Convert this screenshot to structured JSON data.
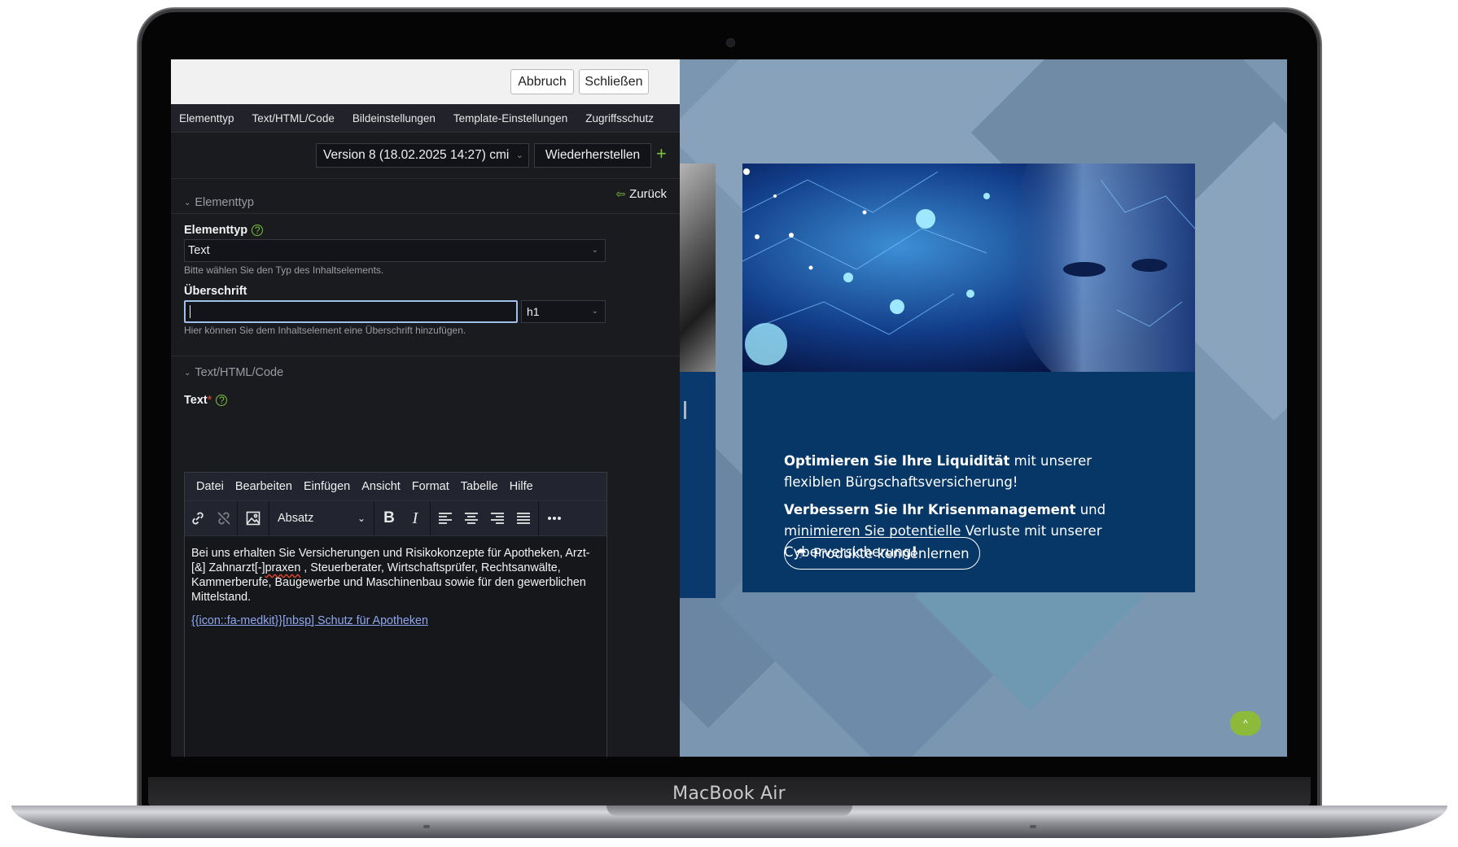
{
  "device": {
    "brand_label": "MacBook Air"
  },
  "editor": {
    "topbar": {
      "cancel_label": "Abbruch",
      "close_label": "Schließen"
    },
    "tabs": [
      "Elementtyp",
      "Text/HTML/Code",
      "Bildeinstellungen",
      "Template-Einstellungen",
      "Zugriffsschutz"
    ],
    "version": {
      "selected": "Version 8 (18.02.2025 14:27) cmi",
      "restore_label": "Wiederherstellen",
      "add_symbol": "+"
    },
    "back_label": "Zurück",
    "section_elementtyp": {
      "heading": "Elementtyp",
      "field_label": "Elementtyp",
      "selected": "Text",
      "hint": "Bitte wählen Sie den Typ des Inhaltselements."
    },
    "headline": {
      "label": "Überschrift",
      "value": "",
      "level": "h1",
      "hint": "Hier können Sie dem Inhaltselement eine Überschrift hinzufügen."
    },
    "section_text": {
      "heading": "Text/HTML/Code",
      "field_label": "Text",
      "required_marker": "*"
    },
    "mce": {
      "menu": [
        "Datei",
        "Bearbeiten",
        "Einfügen",
        "Ansicht",
        "Format",
        "Tabelle",
        "Hilfe"
      ],
      "block_format": "Absatz",
      "paragraph_1_a": "Bei uns erhalten Sie Versicherungen und Risikokonzepte für Apotheken, Arzt- [&] Zahnarzt[-]",
      "paragraph_1_b": "praxen",
      "paragraph_1_c": " , Steuerberater, Wirtschaftsprüfer, Rechtsanwälte, Kammerberufe, Baugewerbe und Maschinenbau sowie für den gewerblichen Mittelstand.",
      "link_text": "{{icon::fa-medkit}}[nbsp] Schutz für Apotheken"
    }
  },
  "preview": {
    "para1_bold": "Optimieren Sie Ihre Liquidität",
    "para1_rest": " mit unserer flexiblen Bürgschaftsversicherung!",
    "para2_bold": "Verbessern Sie Ihr Krisenmanagement",
    "para2_rest": " und minimieren Sie potentielle Verluste mit unserer Cyberversicherung",
    "para2_end": "!",
    "cta_label": "Produkte kennenlernen",
    "to_top_symbol": "^"
  },
  "colors": {
    "accent_green": "#7cc43d",
    "card_blue": "#063767",
    "preview_bg": "#7b96b0",
    "editor_bg": "#1a1b1f"
  }
}
